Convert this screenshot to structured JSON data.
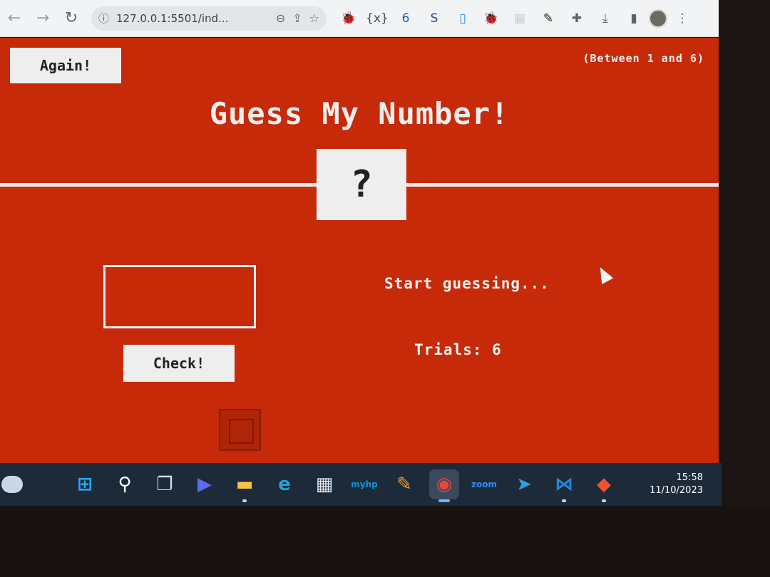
{
  "browser": {
    "url": "127.0.0.1:5501/ind...",
    "back_icon": "arrow-left-icon",
    "forward_icon": "arrow-right-icon",
    "reload_icon": "reload-icon",
    "info_icon": "info-icon",
    "zoom_icon": "zoom-out-icon",
    "share_icon": "share-icon",
    "bookmark_icon": "star-icon",
    "extensions": [
      {
        "name": "bug-icon",
        "glyph": "🐞",
        "color": "#7a8a3a"
      },
      {
        "name": "braces-icon",
        "glyph": "{x}",
        "color": "#4a4f55"
      },
      {
        "name": "extension-6-icon",
        "glyph": "6",
        "color": "#1b5fb3"
      },
      {
        "name": "extension-s-icon",
        "glyph": "S",
        "color": "#2b4a8a"
      },
      {
        "name": "clipboard-icon",
        "glyph": "▯",
        "color": "#1e88e5"
      },
      {
        "name": "bug-icon-2",
        "glyph": "🐞",
        "color": "#7a8a3a"
      },
      {
        "name": "grid-icon",
        "glyph": "▦",
        "color": "#c9cdd2"
      },
      {
        "name": "eyedropper-icon",
        "glyph": "✎",
        "color": "#222"
      },
      {
        "name": "puzzle-icon",
        "glyph": "✚",
        "color": "#5f6368"
      },
      {
        "name": "download-icon",
        "glyph": "⤓",
        "color": "#5f6368"
      },
      {
        "name": "sidebar-icon",
        "glyph": "▮",
        "color": "#5f6368"
      }
    ],
    "menu_icon": "kebab-menu-icon"
  },
  "game": {
    "again_label": "Again!",
    "range_hint": "(Between 1 and 6)",
    "title": "Guess My Number!",
    "secret_display": "?",
    "guess_value": "",
    "check_label": "Check!",
    "message": "Start guessing...",
    "trials_label": "Trials:",
    "trials_value": "6",
    "colors": {
      "background": "#c72a09",
      "panel": "#eeeeee",
      "text": "#eeeeee"
    }
  },
  "taskbar": {
    "apps": [
      {
        "name": "windows-start-icon",
        "glyph": "⊞",
        "color": "#29a8ff",
        "active": false,
        "dot": false
      },
      {
        "name": "search-icon",
        "glyph": "⚲",
        "color": "#ffffff",
        "active": false,
        "dot": false
      },
      {
        "name": "task-view-icon",
        "glyph": "❐",
        "color": "#d8dde3",
        "active": false,
        "dot": false
      },
      {
        "name": "chat-icon",
        "glyph": "▶",
        "color": "#5b6cf0",
        "active": false,
        "dot": false
      },
      {
        "name": "file-explorer-icon",
        "glyph": "▬",
        "color": "#f5c542",
        "active": false,
        "dot": true
      },
      {
        "name": "edge-icon",
        "glyph": "e",
        "color": "#1fa4d4",
        "active": false,
        "dot": false
      },
      {
        "name": "store-icon",
        "glyph": "▦",
        "color": "#e8eaed",
        "active": false,
        "dot": false
      },
      {
        "name": "myhp-icon",
        "glyph": "myhp",
        "color": "#0d94d6",
        "active": false,
        "dot": false
      },
      {
        "name": "pen-app-icon",
        "glyph": "✎",
        "color": "#f39a2c",
        "active": false,
        "dot": false
      },
      {
        "name": "chrome-icon",
        "glyph": "◉",
        "color": "#e8453c",
        "active": true,
        "dot": true
      },
      {
        "name": "zoom-icon",
        "glyph": "zoom",
        "color": "#2d8cff",
        "active": false,
        "dot": false
      },
      {
        "name": "telegram-icon",
        "glyph": "➤",
        "color": "#2aa3de",
        "active": false,
        "dot": false
      },
      {
        "name": "vscode-icon",
        "glyph": "⋈",
        "color": "#1e88e5",
        "active": false,
        "dot": true
      },
      {
        "name": "git-icon",
        "glyph": "◆",
        "color": "#f05133",
        "active": false,
        "dot": true
      }
    ],
    "time": "15:58",
    "date": "11/10/2023"
  }
}
